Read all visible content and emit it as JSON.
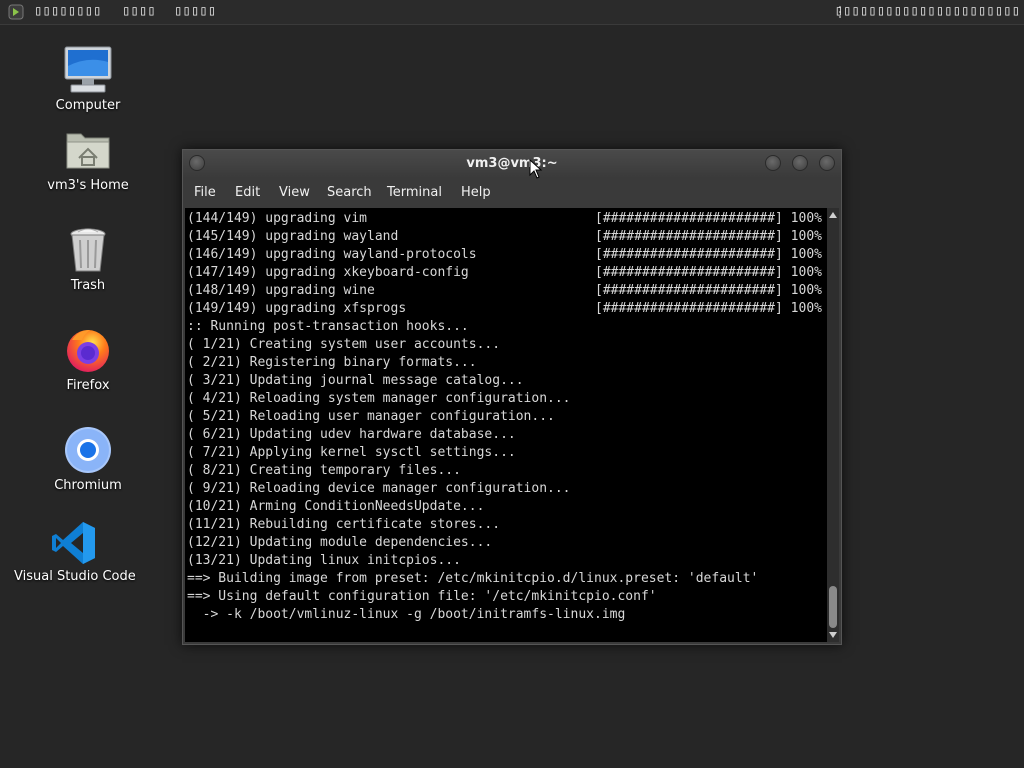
{
  "topbar": {
    "applications": "▯▯▯▯▯▯▯▯",
    "places": "▯▯▯▯",
    "system": "▯▯▯▯▯",
    "clock": "▯▯▯▯▯▯▯▯▯▯▯▯▯▯▯▯▯▯▯▯▯▯"
  },
  "desktop": {
    "icons": [
      {
        "label": "Computer",
        "icon": "computer-icon"
      },
      {
        "label": "vm3's Home",
        "icon": "home-folder-icon"
      },
      {
        "label": "Trash",
        "icon": "trash-icon"
      },
      {
        "label": "Firefox",
        "icon": "firefox-icon"
      },
      {
        "label": "Chromium",
        "icon": "chromium-icon"
      },
      {
        "label": "Visual Studio Code",
        "icon": "vscode-icon"
      }
    ]
  },
  "window": {
    "title": "vm3@vm3:~",
    "menu": [
      "File",
      "Edit",
      "View",
      "Search",
      "Terminal",
      "Help"
    ]
  },
  "terminal": {
    "lines": [
      {
        "text": "(144/149) upgrading vim",
        "bar": "[######################] 100%"
      },
      {
        "text": "(145/149) upgrading wayland",
        "bar": "[######################] 100%"
      },
      {
        "text": "(146/149) upgrading wayland-protocols",
        "bar": "[######################] 100%"
      },
      {
        "text": "(147/149) upgrading xkeyboard-config",
        "bar": "[######################] 100%"
      },
      {
        "text": "(148/149) upgrading wine",
        "bar": "[######################] 100%"
      },
      {
        "text": "(149/149) upgrading xfsprogs",
        "bar": "[######################] 100%"
      },
      {
        "text": ":: Running post-transaction hooks...",
        "bar": ""
      },
      {
        "text": "( 1/21) Creating system user accounts...",
        "bar": ""
      },
      {
        "text": "( 2/21) Registering binary formats...",
        "bar": ""
      },
      {
        "text": "( 3/21) Updating journal message catalog...",
        "bar": ""
      },
      {
        "text": "( 4/21) Reloading system manager configuration...",
        "bar": ""
      },
      {
        "text": "( 5/21) Reloading user manager configuration...",
        "bar": ""
      },
      {
        "text": "( 6/21) Updating udev hardware database...",
        "bar": ""
      },
      {
        "text": "( 7/21) Applying kernel sysctl settings...",
        "bar": ""
      },
      {
        "text": "( 8/21) Creating temporary files...",
        "bar": ""
      },
      {
        "text": "( 9/21) Reloading device manager configuration...",
        "bar": ""
      },
      {
        "text": "(10/21) Arming ConditionNeedsUpdate...",
        "bar": ""
      },
      {
        "text": "(11/21) Rebuilding certificate stores...",
        "bar": ""
      },
      {
        "text": "(12/21) Updating module dependencies...",
        "bar": ""
      },
      {
        "text": "(13/21) Updating linux initcpios...",
        "bar": ""
      },
      {
        "text": "==> Building image from preset: /etc/mkinitcpio.d/linux.preset: 'default'",
        "bar": ""
      },
      {
        "text": "==> Using default configuration file: '/etc/mkinitcpio.conf'",
        "bar": ""
      },
      {
        "text": "  -> -k /boot/vmlinuz-linux -g /boot/initramfs-linux.img",
        "bar": ""
      }
    ]
  }
}
